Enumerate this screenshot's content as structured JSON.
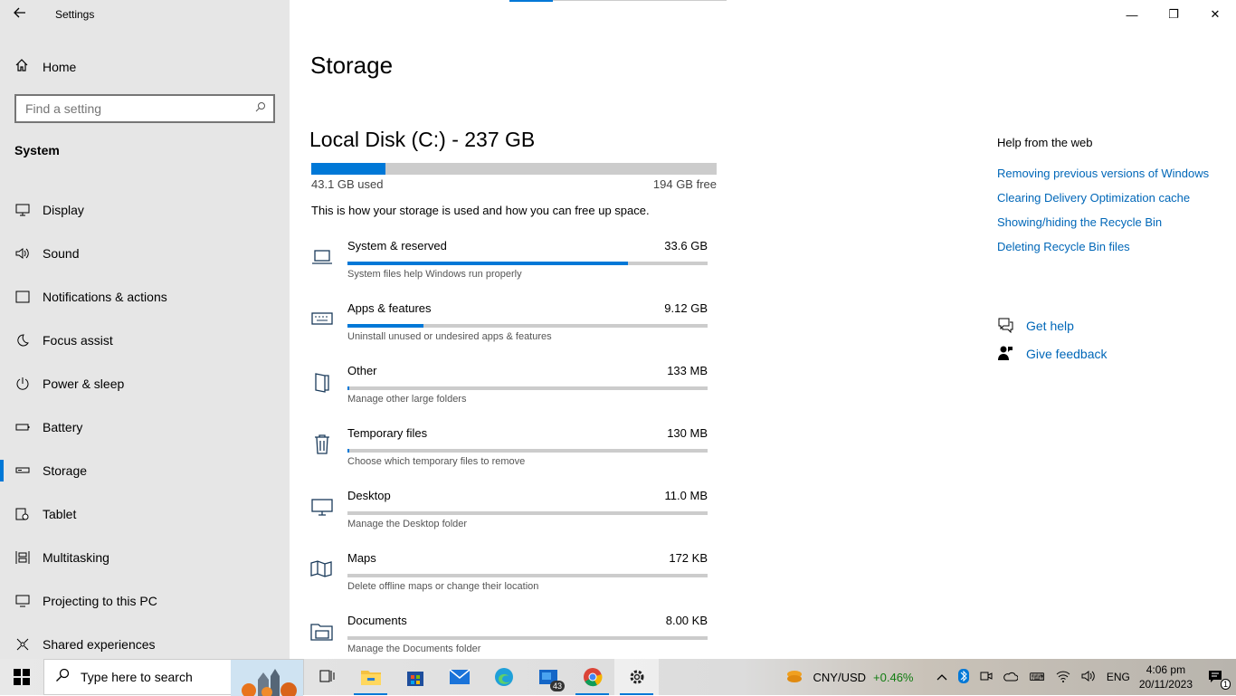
{
  "window": {
    "title": "Settings",
    "minimize": "—",
    "maximize": "❐",
    "close": "✕"
  },
  "sidebar": {
    "home_label": "Home",
    "search_placeholder": "Find a setting",
    "section_title": "System",
    "items": [
      {
        "label": "Display",
        "icon": "display-icon"
      },
      {
        "label": "Sound",
        "icon": "sound-icon"
      },
      {
        "label": "Notifications & actions",
        "icon": "notifications-icon"
      },
      {
        "label": "Focus assist",
        "icon": "focus-assist-icon"
      },
      {
        "label": "Power & sleep",
        "icon": "power-icon"
      },
      {
        "label": "Battery",
        "icon": "battery-icon"
      },
      {
        "label": "Storage",
        "icon": "storage-icon",
        "active": true
      },
      {
        "label": "Tablet",
        "icon": "tablet-icon"
      },
      {
        "label": "Multitasking",
        "icon": "multitasking-icon"
      },
      {
        "label": "Projecting to this PC",
        "icon": "projecting-icon"
      },
      {
        "label": "Shared experiences",
        "icon": "shared-experiences-icon"
      }
    ]
  },
  "main": {
    "title": "Storage",
    "disk": {
      "title": "Local Disk (C:) - 237 GB",
      "used_label": "43.1 GB used",
      "free_label": "194 GB free",
      "used_fraction": 0.182
    },
    "description": "This is how your storage is used and how you can free up space.",
    "categories": [
      {
        "name": "System & reserved",
        "size": "33.6 GB",
        "sub": "System files help Windows run properly",
        "fraction": 0.78,
        "icon": "laptop-icon"
      },
      {
        "name": "Apps & features",
        "size": "9.12 GB",
        "sub": "Uninstall unused or undesired apps & features",
        "fraction": 0.212,
        "icon": "keyboard-icon"
      },
      {
        "name": "Other",
        "size": "133 MB",
        "sub": "Manage other large folders",
        "fraction": 0.003,
        "icon": "folder-icon"
      },
      {
        "name": "Temporary files",
        "size": "130 MB",
        "sub": "Choose which temporary files to remove",
        "fraction": 0.003,
        "icon": "trash-icon"
      },
      {
        "name": "Desktop",
        "size": "11.0 MB",
        "sub": "Manage the Desktop folder",
        "fraction": 0.0,
        "icon": "monitor-icon"
      },
      {
        "name": "Maps",
        "size": "172 KB",
        "sub": "Delete offline maps or change their location",
        "fraction": 0.0,
        "icon": "map-icon"
      },
      {
        "name": "Documents",
        "size": "8.00 KB",
        "sub": "Manage the Documents folder",
        "fraction": 0.0,
        "icon": "documents-icon"
      }
    ]
  },
  "help": {
    "title": "Help from the web",
    "links": [
      "Removing previous versions of Windows",
      "Clearing Delivery Optimization cache",
      "Showing/hiding the Recycle Bin",
      "Deleting Recycle Bin files"
    ],
    "get_help": "Get help",
    "give_feedback": "Give feedback"
  },
  "taskbar": {
    "search_placeholder": "Type here to search",
    "mail_badge": "43",
    "weather": {
      "label": "CNY/USD",
      "change": "+0.46%"
    },
    "lang": "ENG",
    "time": "4:06 pm",
    "date": "20/11/2023",
    "notif_count": "1"
  },
  "colors": {
    "accent": "#0078d7",
    "link": "#0067b8",
    "sidebar_bg": "#e6e6e6",
    "bar_bg": "#cccccc"
  }
}
